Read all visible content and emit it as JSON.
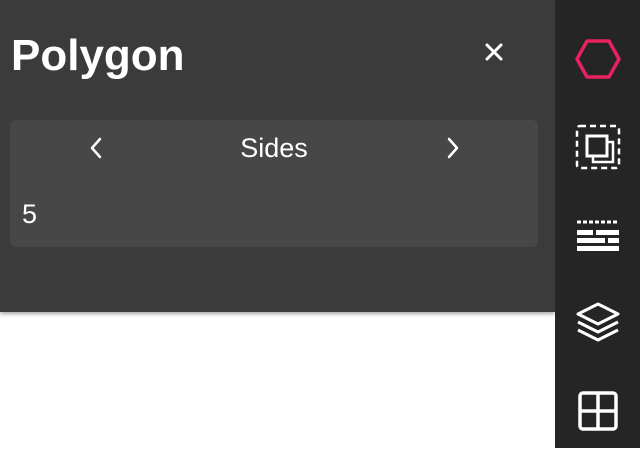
{
  "panel": {
    "title": "Polygon",
    "close_icon": "close-icon"
  },
  "stepper": {
    "label": "Sides",
    "value": "5",
    "prev_icon": "chevron-left-icon",
    "next_icon": "chevron-right-icon"
  },
  "toolbar": {
    "items": [
      {
        "icon": "hexagon-icon",
        "active": true
      },
      {
        "icon": "select-box-icon",
        "active": false
      },
      {
        "icon": "brick-pattern-icon",
        "active": false
      },
      {
        "icon": "layers-icon",
        "active": false
      },
      {
        "icon": "grid-icon",
        "active": false
      }
    ]
  },
  "colors": {
    "panel_bg": "#3b3b3b",
    "stepper_bg": "#474747",
    "toolbar_bg": "#252525",
    "accent": "#e8225e",
    "text": "#ffffff",
    "canvas_bg": "#ffffff"
  }
}
